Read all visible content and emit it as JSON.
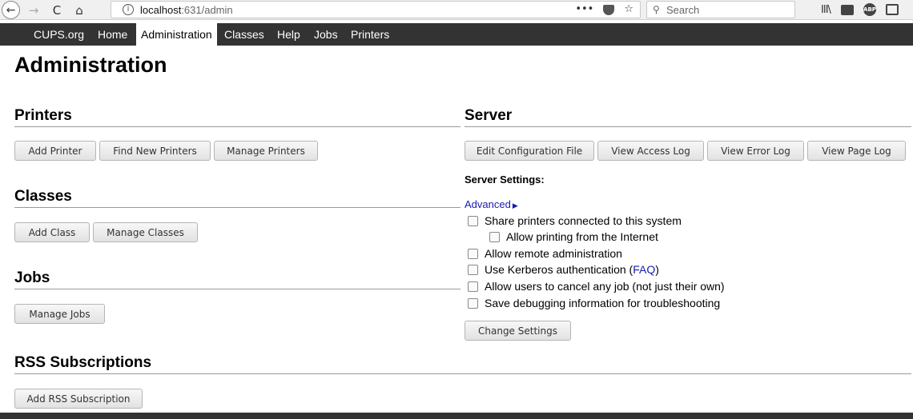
{
  "browser": {
    "back_glyph": "←",
    "forward_glyph": "→",
    "reload_glyph": "C",
    "home_glyph": "⌂",
    "info_glyph": "i",
    "url_host": "localhost",
    "url_rest": ":631/admin",
    "page_actions_glyph": "•••",
    "star_glyph": "☆",
    "search_glyph": "⚲",
    "search_placeholder": "Search",
    "library_glyph": "III\\",
    "abp_label": "ABP"
  },
  "nav": {
    "items": [
      {
        "label": "CUPS.org"
      },
      {
        "label": "Home"
      },
      {
        "label": "Administration",
        "active": true
      },
      {
        "label": "Classes"
      },
      {
        "label": "Help"
      },
      {
        "label": "Jobs"
      },
      {
        "label": "Printers"
      }
    ]
  },
  "page": {
    "title": "Administration"
  },
  "printers": {
    "heading": "Printers",
    "buttons": [
      "Add Printer",
      "Find New Printers",
      "Manage Printers"
    ]
  },
  "classes": {
    "heading": "Classes",
    "buttons": [
      "Add Class",
      "Manage Classes"
    ]
  },
  "jobs": {
    "heading": "Jobs",
    "buttons": [
      "Manage Jobs"
    ]
  },
  "rss": {
    "heading": "RSS Subscriptions",
    "buttons": [
      "Add RSS Subscription"
    ]
  },
  "server": {
    "heading": "Server",
    "buttons": [
      "Edit Configuration File",
      "View Access Log",
      "View Error Log",
      "View Page Log"
    ],
    "settings_label": "Server Settings:",
    "advanced_label": "Advanced",
    "advanced_arrow": "▶",
    "options": [
      {
        "label": "Share printers connected to this system",
        "checked": false
      },
      {
        "label": "Allow printing from the Internet",
        "checked": false
      },
      {
        "label": "Allow remote administration",
        "checked": false
      },
      {
        "label": "Use Kerberos authentication (",
        "link": "FAQ",
        "suffix": ")",
        "checked": false
      },
      {
        "label": "Allow users to cancel any job (not just their own)",
        "checked": false
      },
      {
        "label": "Save debugging information for troubleshooting",
        "checked": false
      }
    ],
    "change_settings_label": "Change Settings"
  }
}
